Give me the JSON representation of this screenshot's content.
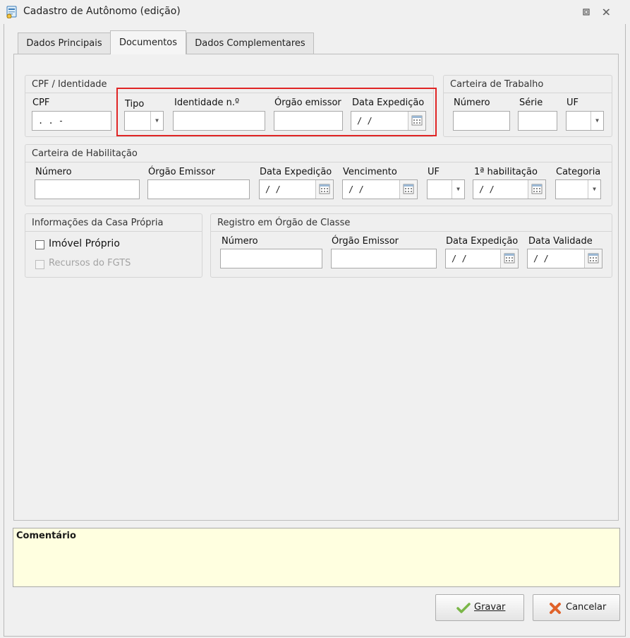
{
  "window": {
    "title": "Cadastro de Autônomo (edição)",
    "btn_restore": "□",
    "btn_close": "✕"
  },
  "tabs": [
    {
      "label": "Dados Principais"
    },
    {
      "label": "Documentos"
    },
    {
      "label": "Dados Complementares"
    }
  ],
  "cpf_group": {
    "title": "CPF / Identidade",
    "cpf_label": "CPF",
    "cpf_value": " .  .  -",
    "tipo_label": "Tipo",
    "tipo_value": "",
    "identidade_label": "Identidade n.º",
    "identidade_value": "",
    "orgao_label": "Órgão emissor",
    "orgao_value": "",
    "data_label": "Data Expedição",
    "data_value": "/ /"
  },
  "carteira_trabalho": {
    "title": "Carteira de Trabalho",
    "numero_label": "Número",
    "numero_value": "",
    "serie_label": "Série",
    "serie_value": "",
    "uf_label": "UF",
    "uf_value": ""
  },
  "habilitacao": {
    "title": "Carteira de Habilitação",
    "numero_label": "Número",
    "numero_value": "",
    "orgao_label": "Órgão Emissor",
    "orgao_value": "",
    "data_label": "Data Expedição",
    "data_value": "/ /",
    "venc_label": "Vencimento",
    "venc_value": "/ /",
    "uf_label": "UF",
    "uf_value": "",
    "primeira_label": "1ª habilitação",
    "primeira_value": "/ /",
    "categoria_label": "Categoria",
    "categoria_value": ""
  },
  "casa_propria": {
    "title": "Informações da Casa Própria",
    "imovel_label": "Imóvel Próprio",
    "imovel_checked": false,
    "fgts_label": "Recursos do FGTS",
    "fgts_checked": false
  },
  "orgao_classe": {
    "title": "Registro em Órgão de Classe",
    "numero_label": "Número",
    "numero_value": "",
    "orgao_label": "Órgão Emissor",
    "orgao_value": "",
    "data_exp_label": "Data Expedição",
    "data_exp_value": "/ /",
    "data_val_label": "Data Validade",
    "data_val_value": "/ /"
  },
  "comment": {
    "label": "Comentário",
    "value": ""
  },
  "buttons": {
    "save_label": "Gravar",
    "cancel_label": "Cancelar"
  },
  "colors": {
    "highlight": "#e02525",
    "comment_bg": "#ffffe0",
    "save_icon": "#7ab648",
    "cancel_icon": "#e0622a"
  }
}
